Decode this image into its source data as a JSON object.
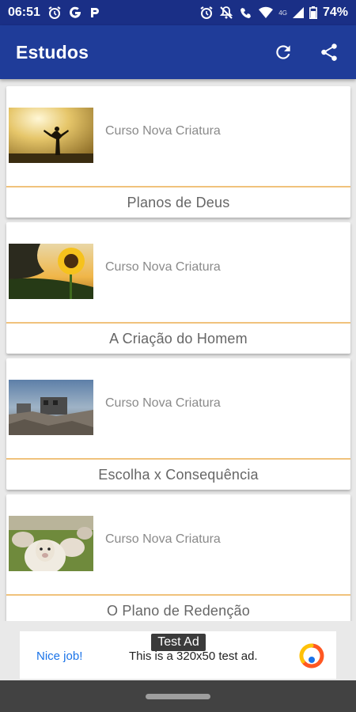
{
  "status_bar": {
    "time": "06:51",
    "battery": "74%",
    "net_small": "4G"
  },
  "app_bar": {
    "title": "Estudos",
    "refresh_icon": "refresh-icon",
    "share_icon": "share-icon"
  },
  "studies": [
    {
      "course": "Curso Nova Criatura",
      "title": "Planos de Deus",
      "image": "person-sunset-image"
    },
    {
      "course": "Curso Nova Criatura",
      "title": "A Criação do Homem",
      "image": "sunflower-image"
    },
    {
      "course": "Curso Nova Criatura",
      "title": "Escolha x Consequência",
      "image": "ruins-image"
    },
    {
      "course": "Curso Nova Criatura",
      "title": "O Plano de Redenção",
      "image": "sheep-image"
    }
  ],
  "ad": {
    "label": "Test Ad",
    "cta": "Nice job!",
    "text": "This is a 320x50 test ad."
  },
  "colors": {
    "primary": "#1f3c99",
    "status": "#1a2f86",
    "divider": "#f0c27c"
  }
}
